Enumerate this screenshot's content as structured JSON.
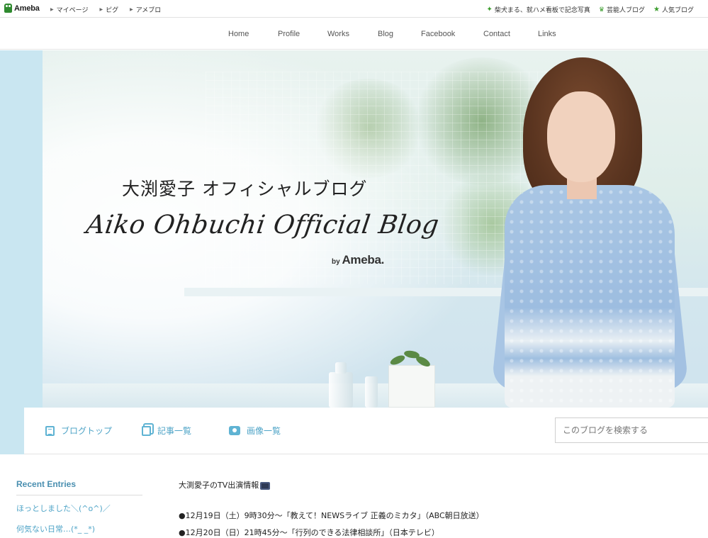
{
  "topbar": {
    "logo": "Ameba",
    "links": [
      "マイページ",
      "ピグ",
      "アメブロ"
    ],
    "right_links": [
      "柴犬まる、就ハメ看板で記念写真",
      "芸能人ブログ",
      "人気ブログ"
    ]
  },
  "nav": [
    "Home",
    "Profile",
    "Works",
    "Blog",
    "Facebook",
    "Contact",
    "Links"
  ],
  "hero": {
    "jp_title": "大渕愛子 オフィシャルブログ",
    "en_title": "Aiko Ohbuchi Official Blog",
    "by": "by",
    "brand": "Ameba."
  },
  "subnav": {
    "items": [
      "ブログトップ",
      "記事一覧",
      "画像一覧"
    ],
    "search_placeholder": "このブログを検索する"
  },
  "sidebar": {
    "title": "Recent Entries",
    "entries": [
      "ほっとしました＼(^o^)／",
      "何気ない日常…(*_ _*)"
    ]
  },
  "article": {
    "title": "大渕愛子のTV出演情報",
    "lines": [
      "●12月19日（土）9時30分〜「教えて！NEWSライブ 正義のミカタ」（ABC朝日放送）",
      "●12月20日（日）21時45分〜「行列のできる法律相談所」（日本テレビ）"
    ]
  },
  "colors": {
    "accent_link": "#4fa4c7",
    "sidebar_title": "#4a8fb0",
    "hero_side": "#c9e6f1",
    "ameba_green": "#3b9d2d"
  },
  "icons": [
    "ameba-frog-icon",
    "arrow-right-icon",
    "star-icon",
    "crown-icon",
    "list-icon",
    "copy-icon",
    "camera-icon",
    "tv-icon"
  ]
}
